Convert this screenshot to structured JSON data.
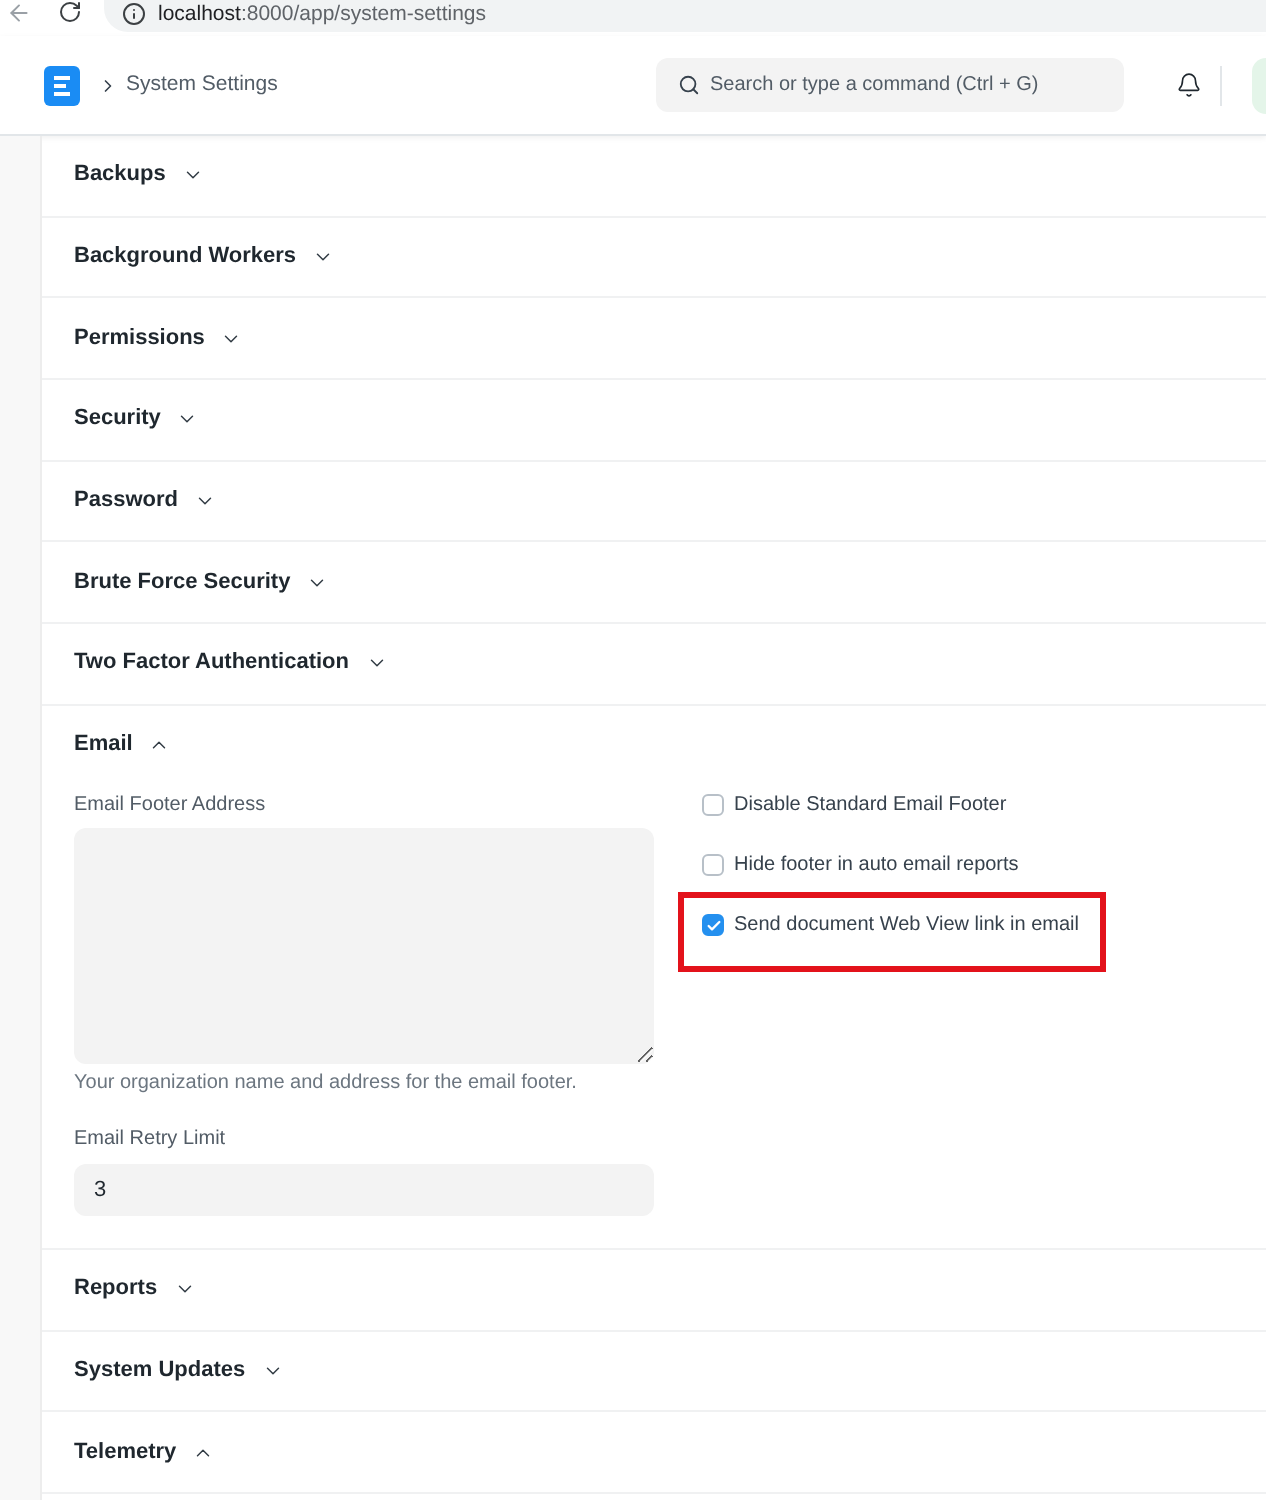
{
  "browser": {
    "url": {
      "host": "localhost",
      "path": ":8000/app/system-settings"
    }
  },
  "navbar": {
    "breadcrumb": "System Settings",
    "search": {
      "placeholder": "Search or type a command (Ctrl + G)"
    }
  },
  "sections": [
    {
      "title": "Backups",
      "expanded": false
    },
    {
      "title": "Background Workers",
      "expanded": false
    },
    {
      "title": "Permissions",
      "expanded": false
    },
    {
      "title": "Security",
      "expanded": false
    },
    {
      "title": "Password",
      "expanded": false
    },
    {
      "title": "Brute Force Security",
      "expanded": false
    },
    {
      "title": "Two Factor Authentication",
      "expanded": false
    },
    {
      "title": "Email",
      "expanded": true,
      "fields": [
        {
          "kind": "textarea",
          "label": "Email Footer Address",
          "description": "Your organization name and address for the email footer."
        },
        {
          "kind": "input",
          "label": "Email Retry Limit",
          "value": "3"
        }
      ],
      "checkboxes": [
        {
          "label": "Disable Standard Email Footer",
          "checked": false,
          "highlighted": false
        },
        {
          "label": "Hide footer in auto email reports",
          "checked": false,
          "highlighted": false
        },
        {
          "label": "Send document Web View link in email",
          "checked": true,
          "highlighted": true
        }
      ]
    },
    {
      "title": "Reports",
      "expanded": false
    },
    {
      "title": "System Updates",
      "expanded": false
    },
    {
      "title": "Telemetry",
      "expanded": true
    }
  ]
}
